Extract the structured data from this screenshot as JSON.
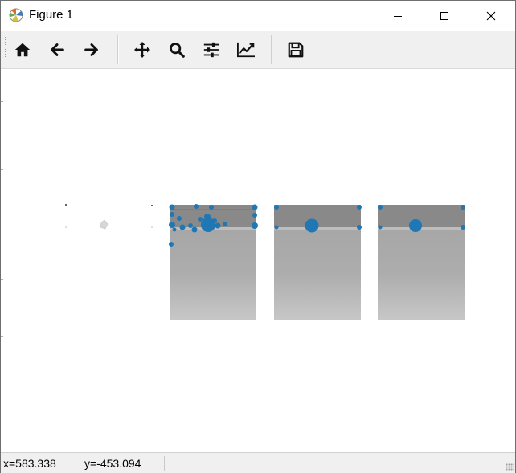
{
  "window": {
    "title": "Figure 1",
    "app_icon": "matplotlib-icon",
    "controls": [
      "minimize-icon",
      "maximize-icon",
      "close-icon"
    ]
  },
  "toolbar": {
    "buttons": [
      {
        "name": "home",
        "icon": "home-icon"
      },
      {
        "name": "back",
        "icon": "arrow-left-icon"
      },
      {
        "name": "forward",
        "icon": "arrow-right-icon"
      },
      {
        "name": "pan",
        "icon": "move-icon"
      },
      {
        "name": "zoom",
        "icon": "magnifier-icon"
      },
      {
        "name": "subplots",
        "icon": "sliders-icon"
      },
      {
        "name": "customize",
        "icon": "chart-line-icon"
      },
      {
        "name": "save",
        "icon": "floppy-disk-icon"
      }
    ]
  },
  "figure": {
    "panels": [
      {
        "name": "sparse-points",
        "content": "few faint markers on white"
      },
      {
        "name": "image-with-keypoints-dense"
      },
      {
        "name": "image-with-keypoints-sparse-1"
      },
      {
        "name": "image-with-keypoints-sparse-2"
      }
    ],
    "marker_color": "#1f77b4"
  },
  "statusbar": {
    "x_text": "x=583.338",
    "y_text": "y=-453.094"
  },
  "colors": {
    "toolbar_bg": "#f0f0f0",
    "image_band": "#8b8b8b",
    "image_body": "#a9a9a9",
    "marker": "#1f77b4"
  }
}
